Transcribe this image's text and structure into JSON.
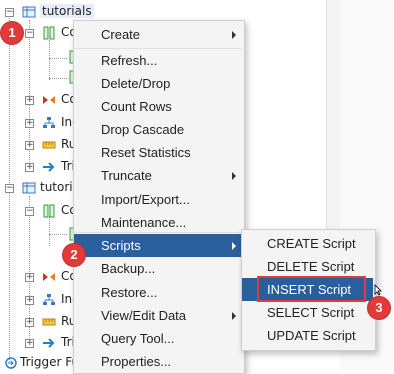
{
  "tree": {
    "items": [
      {
        "label": "tutorials",
        "icon": "table-icon"
      },
      {
        "label": "Co",
        "icon": "columns-icon"
      },
      {
        "label": "Co",
        "icon": "constraints-icon"
      },
      {
        "label": "Ind",
        "icon": "indexes-icon"
      },
      {
        "label": "Ru",
        "icon": "rules-icon"
      },
      {
        "label": "Tri",
        "icon": "triggers-icon"
      },
      {
        "label": "tutoria",
        "icon": "table-icon"
      },
      {
        "label": "Co",
        "icon": "columns-icon"
      },
      {
        "label": "Co",
        "icon": "constraints-icon"
      },
      {
        "label": "Ind",
        "icon": "indexes-icon"
      },
      {
        "label": "Ru",
        "icon": "rules-icon"
      },
      {
        "label": "Tri",
        "icon": "triggers-icon"
      },
      {
        "label": "Trigger Fu",
        "icon": "trigger-functions-icon"
      }
    ]
  },
  "context_menu": {
    "items": [
      {
        "label": "Create",
        "submenu": true
      },
      {
        "label": "Refresh...",
        "submenu": false
      },
      {
        "label": "Delete/Drop",
        "submenu": false
      },
      {
        "label": "Count Rows",
        "submenu": false
      },
      {
        "label": "Drop Cascade",
        "submenu": false
      },
      {
        "label": "Reset Statistics",
        "submenu": false
      },
      {
        "label": "Truncate",
        "submenu": true
      },
      {
        "label": "Import/Export...",
        "submenu": false
      },
      {
        "label": "Maintenance...",
        "submenu": false
      },
      {
        "label": "Scripts",
        "submenu": true,
        "active": true
      },
      {
        "label": "Backup...",
        "submenu": false
      },
      {
        "label": "Restore...",
        "submenu": false
      },
      {
        "label": "View/Edit Data",
        "submenu": true
      },
      {
        "label": "Query Tool...",
        "submenu": false
      },
      {
        "label": "Properties...",
        "submenu": false
      }
    ]
  },
  "scripts_submenu": {
    "items": [
      {
        "label": "CREATE Script"
      },
      {
        "label": "DELETE Script"
      },
      {
        "label": "INSERT Script",
        "highlighted": true
      },
      {
        "label": "SELECT Script"
      },
      {
        "label": "UPDATE Script"
      }
    ]
  },
  "annotations": {
    "badge_1": "1",
    "badge_2": "2",
    "badge_3": "3"
  },
  "colors": {
    "active_item": "#2a5f9e",
    "annotation_red": "#e23a3a",
    "menu_bg": "#f4f4f4"
  }
}
